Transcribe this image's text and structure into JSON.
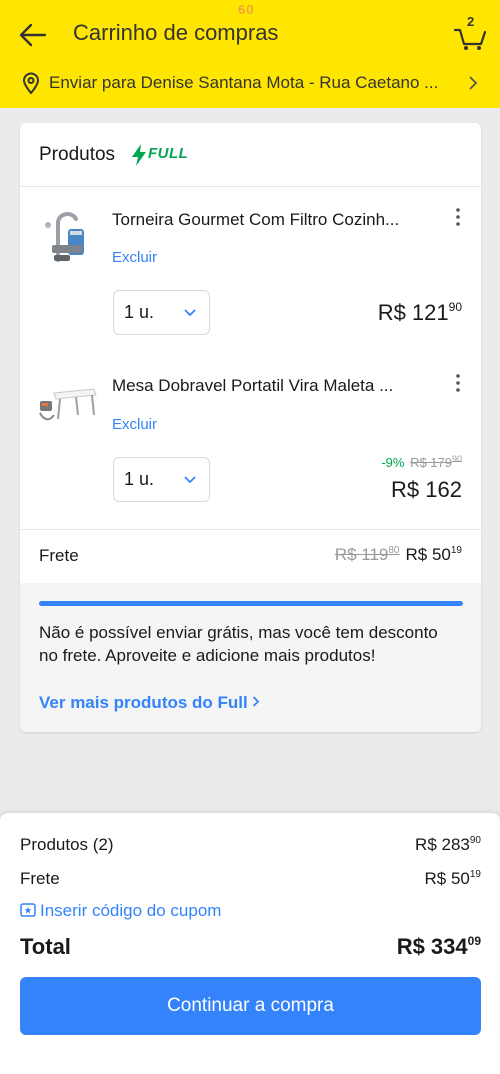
{
  "status": {
    "fps": "60"
  },
  "header": {
    "title": "Carrinho de compras",
    "cart_count": "2",
    "address": "Enviar para Denise Santana Mota - Rua Caetano ..."
  },
  "card": {
    "title": "Produtos",
    "badge": "FULL",
    "items": [
      {
        "name": "Torneira Gourmet Com Filtro Cozinh...",
        "remove_label": "Excluir",
        "qty": "1 u.",
        "price_int": "R$ 121",
        "price_cents": "90"
      },
      {
        "name": "Mesa Dobravel Portatil Vira Maleta ...",
        "remove_label": "Excluir",
        "qty": "1 u.",
        "discount": "-9%",
        "old_price_int": "R$ 179",
        "old_price_cents": "90",
        "price_int": "R$ 162",
        "price_cents": ""
      }
    ],
    "freight": {
      "label": "Frete",
      "old_int": "R$ 119",
      "old_cents": "80",
      "new_int": "R$ 50",
      "new_cents": "19"
    },
    "promo": {
      "progress": 1.0,
      "message": "Não é possível enviar grátis, mas você tem desconto no frete. Aproveite e adicione mais produtos!",
      "link": "Ver mais produtos do Full"
    }
  },
  "summary": {
    "products_label": "Produtos (2)",
    "products_int": "R$ 283",
    "products_cents": "90",
    "freight_label": "Frete",
    "freight_int": "R$ 50",
    "freight_cents": "19",
    "coupon_label": "Inserir código do cupom",
    "total_label": "Total",
    "total_int": "R$ 334",
    "total_cents": "09",
    "cta_label": "Continuar a compra"
  },
  "colors": {
    "header_bg": "#ffe600",
    "accent": "#3483fa",
    "green": "#00a650"
  }
}
